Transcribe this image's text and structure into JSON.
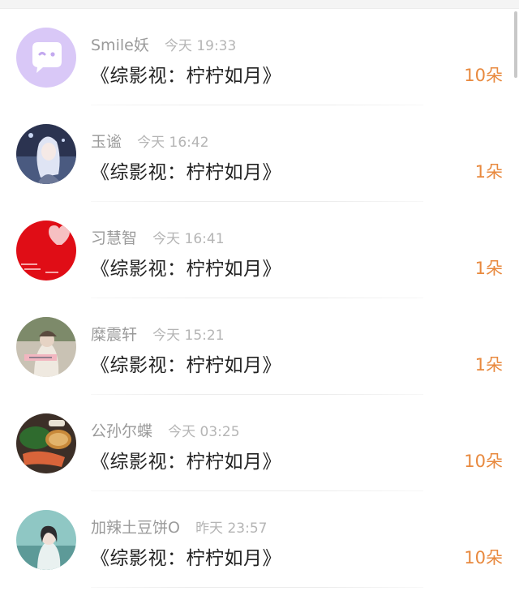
{
  "comments": [
    {
      "user": "Smile妖",
      "time": "今天 19:33",
      "book": "《综影视：柠柠如月》",
      "gift": "10朵",
      "avatar": "robot-chat-avatar"
    },
    {
      "user": "玉谧",
      "time": "今天 16:42",
      "book": "《综影视：柠柠如月》",
      "gift": "1朵",
      "avatar": "anime-girl-avatar"
    },
    {
      "user": "习慧智",
      "time": "今天 16:41",
      "book": "《综影视：柠柠如月》",
      "gift": "1朵",
      "avatar": "red-heart-avatar"
    },
    {
      "user": "糜震轩",
      "time": "今天 15:21",
      "book": "《综影视：柠柠如月》",
      "gift": "1朵",
      "avatar": "photo-girl-avatar"
    },
    {
      "user": "公孙尔蝶",
      "time": "今天 03:25",
      "book": "《综影视：柠柠如月》",
      "gift": "10朵",
      "avatar": "food-avatar"
    },
    {
      "user": "加辣土豆饼O",
      "time": "昨天 23:57",
      "book": "《综影视：柠柠如月》",
      "gift": "10朵",
      "avatar": "teal-portrait-avatar"
    }
  ],
  "colors": {
    "accent": "#e8893e",
    "name": "#9a9a9a",
    "time": "#b5b5b5",
    "title": "#222222"
  }
}
